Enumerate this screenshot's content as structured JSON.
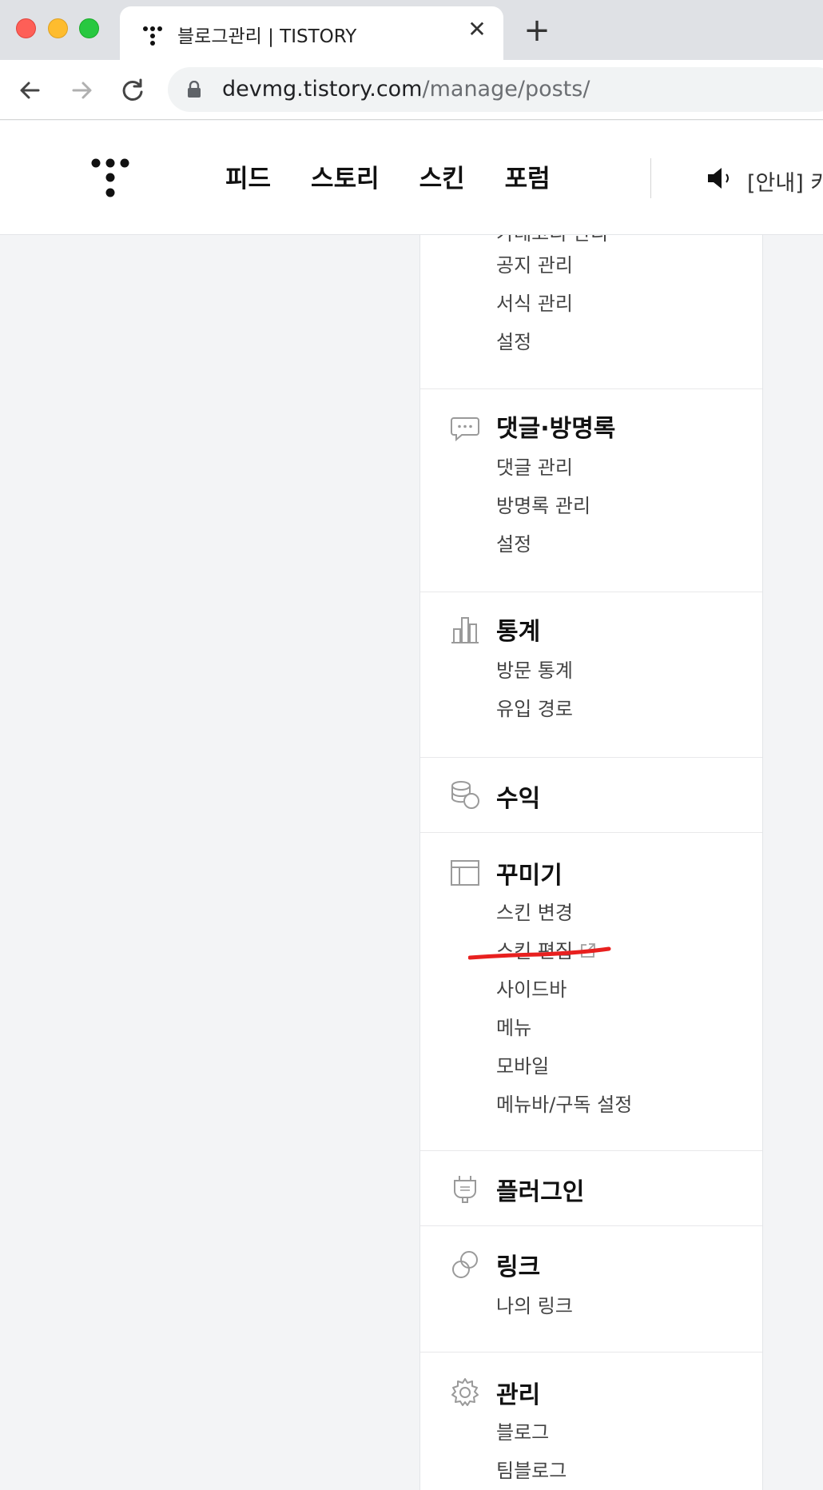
{
  "browser": {
    "tab_title": "블로그관리 | TISTORY",
    "tab_close_glyph": "✕",
    "new_tab_glyph": "+",
    "url_host": "devmg.tistory.com",
    "url_path": "/manage/posts/"
  },
  "header": {
    "nav": [
      "피드",
      "스토리",
      "스킨",
      "포럼"
    ],
    "notice": "[안내] 카"
  },
  "sidebar": {
    "cut_item": "카테고리 관리",
    "post_items": [
      "공지 관리",
      "서식 관리",
      "설정"
    ],
    "comments": {
      "title": "댓글·방명록",
      "items": [
        "댓글 관리",
        "방명록 관리",
        "설정"
      ]
    },
    "stats": {
      "title": "통계",
      "items": [
        "방문 통계",
        "유입 경로"
      ]
    },
    "revenue": {
      "title": "수익"
    },
    "decorate": {
      "title": "꾸미기",
      "items": [
        "스킨 변경",
        "스킨 편집",
        "사이드바",
        "메뉴",
        "모바일",
        "메뉴바/구독 설정"
      ]
    },
    "plugin": {
      "title": "플러그인"
    },
    "link": {
      "title": "링크",
      "items": [
        "나의 링크"
      ]
    },
    "manage": {
      "title": "관리",
      "items": [
        "블로그",
        "팀블로그"
      ]
    }
  },
  "colors": {
    "annotation_red": "#e8201f",
    "icon_gray": "#9a9a9a"
  },
  "icons": [
    "tistory-logo-icon",
    "back-arrow-icon",
    "forward-arrow-icon",
    "reload-icon",
    "lock-icon",
    "speaker-icon",
    "comment-icon",
    "bar-chart-icon",
    "coins-icon",
    "layout-icon",
    "plug-icon",
    "link-icon",
    "gear-icon",
    "external-link-icon"
  ]
}
